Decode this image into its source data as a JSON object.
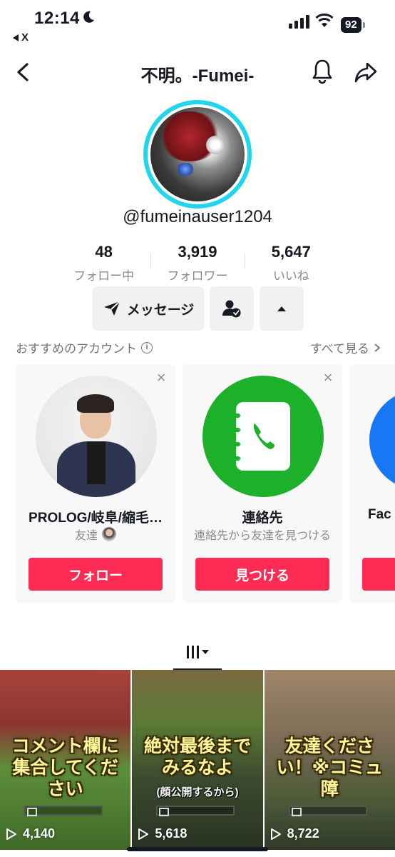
{
  "status_bar": {
    "time": "12:14",
    "back_app": "X",
    "battery": "92"
  },
  "header": {
    "title": "不明。-Fumei-"
  },
  "profile": {
    "username": "@fumeinauser1204",
    "stats": [
      {
        "value": "48",
        "label": "フォロー中"
      },
      {
        "value": "3,919",
        "label": "フォロワー"
      },
      {
        "value": "5,647",
        "label": "いいね"
      }
    ],
    "message_label": "メッセージ"
  },
  "suggested": {
    "title": "おすすめのアカウント",
    "see_all": "すべて見る",
    "cards": [
      {
        "name": "PROLOG/岐阜/縮毛…",
        "sub": "友達",
        "button": "フォロー"
      },
      {
        "name": "連絡先",
        "sub": "連絡先から友達を見つける",
        "button": "見つける"
      },
      {
        "name": "Fac",
        "sub": "",
        "button": ""
      }
    ]
  },
  "videos": [
    {
      "caption": "コメント欄に集合してください",
      "sub": "",
      "views": "4,140"
    },
    {
      "caption": "絶対最後までみるなよ",
      "sub": "(顔公開するから)",
      "views": "5,618"
    },
    {
      "caption": "友達ください！※コミュ障",
      "sub": "",
      "views": "8,722"
    }
  ],
  "colors": {
    "accent": "#fe2c55",
    "ring": "#20d5ec",
    "contacts_green": "#1db12b"
  }
}
